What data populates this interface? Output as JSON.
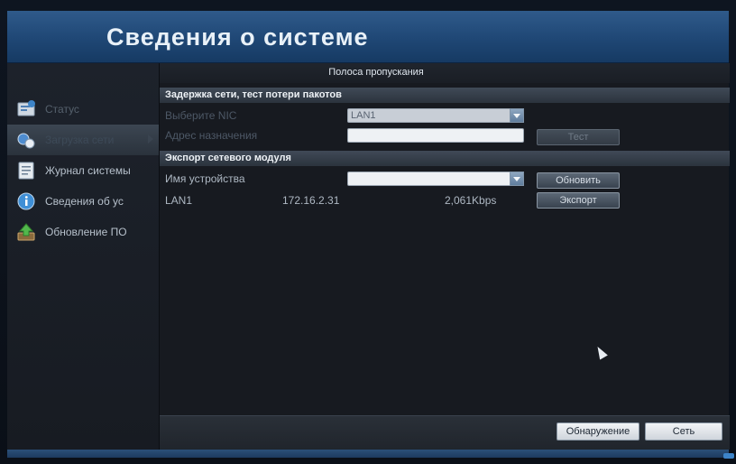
{
  "window": {
    "title": "Сведения о системе"
  },
  "sidebar": {
    "items": [
      {
        "label": "Статус",
        "icon": "status-icon"
      },
      {
        "label": "Загрузка сети",
        "icon": "network-icon",
        "active": true
      },
      {
        "label": "Журнал системы",
        "icon": "log-icon"
      },
      {
        "label": "Сведения об ус",
        "icon": "info-icon"
      },
      {
        "label": "Обновление ПО",
        "icon": "upgrade-icon"
      }
    ]
  },
  "main": {
    "tab_label": "Полоса пропускания",
    "delay_section": {
      "title": "Задержка сети, тест потери пакотов",
      "nic_label": "Выберите NIC",
      "nic_value": "LAN1",
      "dest_label": "Адрес назначения",
      "dest_value": "",
      "test_button": "Тест"
    },
    "export_section": {
      "title": "Экспорт сетевого модуля",
      "device_label": "Имя устройства",
      "device_value": "",
      "refresh_button": "Обновить",
      "export_button": "Экспорт",
      "row": {
        "name": "LAN1",
        "ip": "172.16.2.31",
        "rate": "2,061Kbps"
      }
    },
    "footer": {
      "detect_button": "Обнаружение",
      "network_button": "Сеть"
    }
  },
  "colors": {
    "title_bar": "#1f4775",
    "accent": "#3d84c8"
  }
}
